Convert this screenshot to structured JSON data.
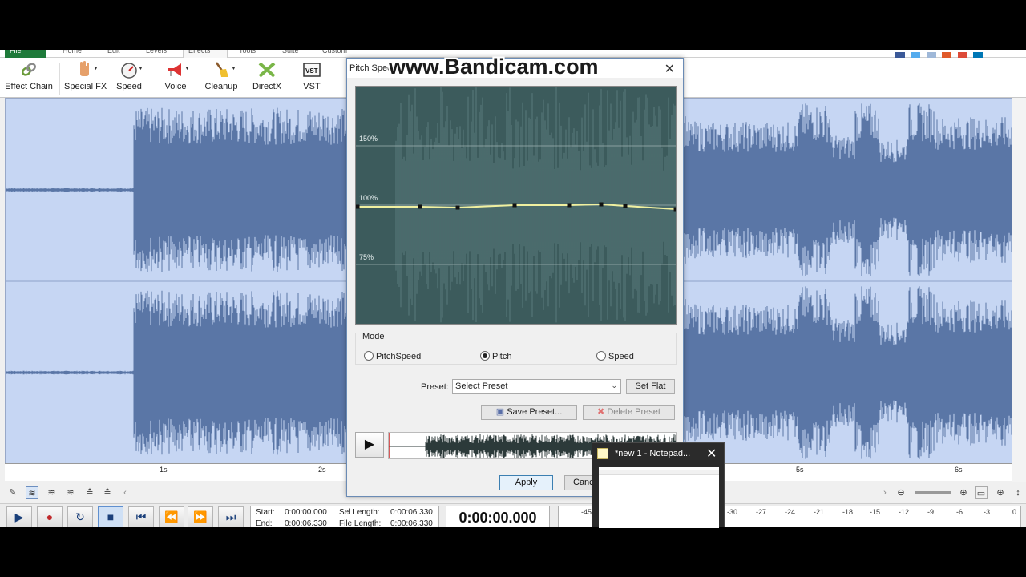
{
  "watermark": "www.Bandicam.com",
  "ribbon": {
    "tabs": [
      "File",
      "Home",
      "Edit",
      "Levels",
      "Effects",
      "Tools",
      "Suite",
      "Custom"
    ]
  },
  "toolbar": {
    "effect_chain": "Effect Chain",
    "special_fx": "Special FX",
    "speed": "Speed",
    "voice": "Voice",
    "cleanup": "Cleanup",
    "directx": "DirectX",
    "vst": "VST"
  },
  "ruler": {
    "labels": [
      "1s",
      "2s",
      "5s",
      "6s"
    ]
  },
  "transport": {
    "start_label": "Start:",
    "start_value": "0:00:00.000",
    "end_label": "End:",
    "end_value": "0:00:06.330",
    "sel_length_label": "Sel Length:",
    "sel_length_value": "0:00:06.330",
    "file_length_label": "File Length:",
    "file_length_value": "0:00:06.330",
    "time_display": "0:00:00.000"
  },
  "meter": {
    "labels": [
      "-45",
      "-30",
      "-27",
      "-24",
      "-21",
      "-18",
      "-15",
      "-12",
      "-9",
      "-6",
      "-3",
      "0"
    ]
  },
  "dialog": {
    "title": "Pitch Speed",
    "graph_labels": {
      "high": "150%",
      "mid": "100%",
      "low": "75%"
    },
    "mode_legend": "Mode",
    "modes": {
      "pitchspeed": "PitchSpeed",
      "pitch": "Pitch",
      "speed": "Speed"
    },
    "selected_mode": "pitch",
    "preset_label": "Preset:",
    "preset_value": "Select Preset",
    "set_flat": "Set Flat",
    "save_preset": "Save Preset...",
    "delete_preset": "Delete Preset",
    "apply": "Apply",
    "cancel": "Canc"
  },
  "notepad": {
    "title": "*new 1 - Notepad..."
  },
  "colors": {
    "waveform_bg": "#c6d6f3",
    "waveform_fg": "#5a76a6",
    "graph_bg": "#3c5b5c",
    "pitch_line": "#f0f0a0",
    "file_tab": "#1e7a3a"
  }
}
